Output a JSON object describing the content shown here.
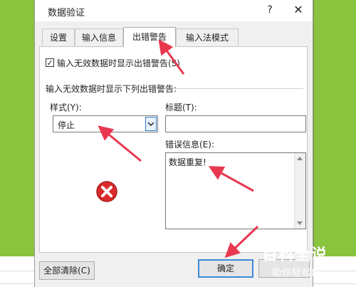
{
  "dialog": {
    "title": "数据验证",
    "help": "?",
    "close": "✕"
  },
  "tabs": [
    {
      "label": "设置",
      "active": false
    },
    {
      "label": "输入信息",
      "active": false
    },
    {
      "label": "出错警告",
      "active": true
    },
    {
      "label": "输入法模式",
      "active": false
    }
  ],
  "error_alert": {
    "show_alert_checkbox_checked": true,
    "show_alert_label": "输入无效数据时显示出错警告(S)",
    "section_label": "输入无效数据时显示下列出错警告:",
    "style_label": "样式(Y):",
    "style_value": "停止",
    "title_label": "标题(T):",
    "title_value": "",
    "message_label": "错误信息(E):",
    "message_value": "数据重复!"
  },
  "buttons": {
    "clear_all": "全部清除(C)",
    "ok": "确定"
  },
  "watermark": {
    "title": "百科全说",
    "subtitle": "助你轻松解决"
  },
  "colors": {
    "sheet_green": "#8ac33e",
    "annotation_red": "#e8384f",
    "error_icon_red": "#d92b2b"
  }
}
